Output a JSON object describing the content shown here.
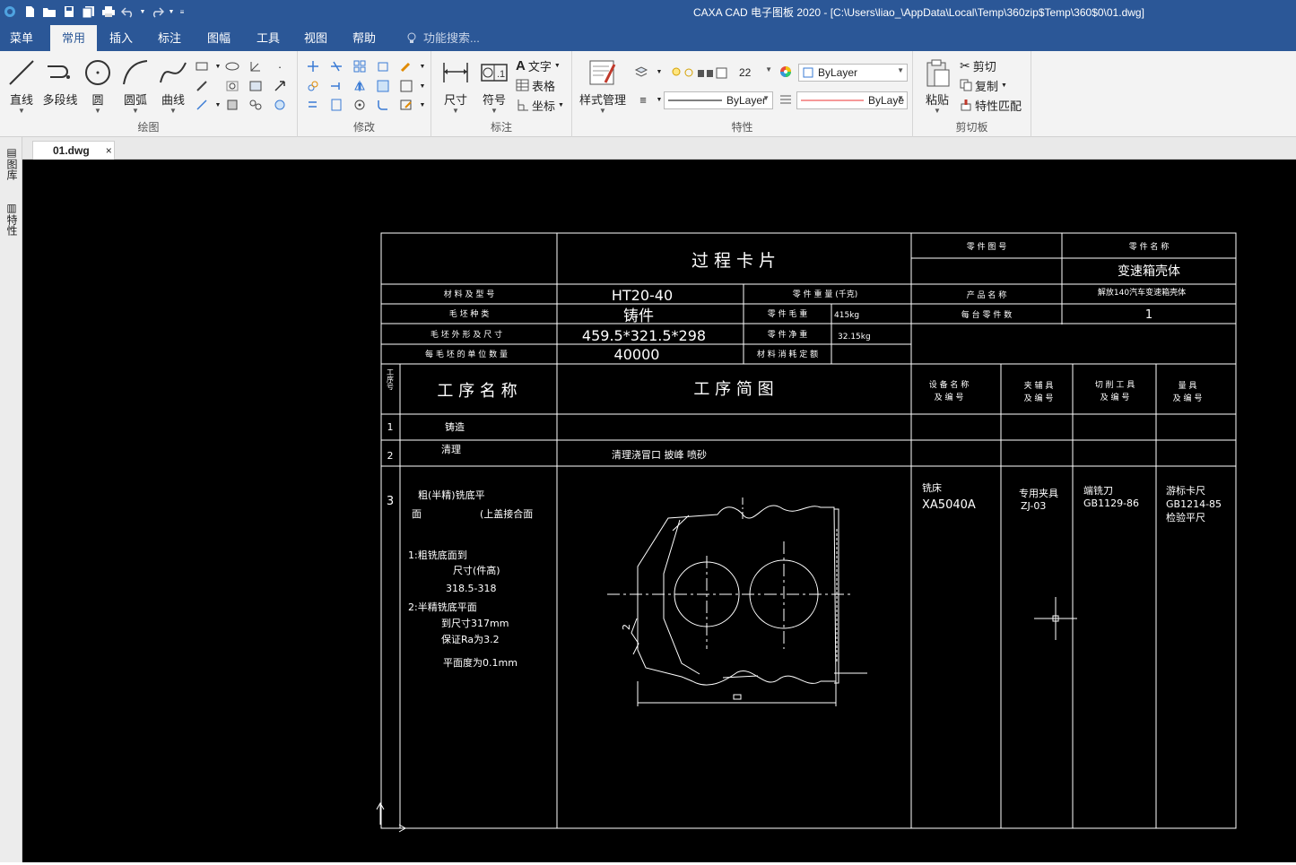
{
  "app": {
    "title": "CAXA CAD 电子图板 2020 - [C:\\Users\\liao_\\AppData\\Local\\Temp\\360zip$Temp\\360$0\\01.dwg]"
  },
  "menu": {
    "tabs": [
      "菜单",
      "常用",
      "插入",
      "标注",
      "图幅",
      "工具",
      "视图",
      "帮助"
    ],
    "active": "常用",
    "search_placeholder": "功能搜索..."
  },
  "ribbon": {
    "draw": {
      "label": "绘图",
      "line": "直线",
      "polyline": "多段线",
      "circle": "圆",
      "arc": "圆弧",
      "curve": "曲线"
    },
    "modify": {
      "label": "修改"
    },
    "annotate": {
      "label": "标注",
      "dimension": "尺寸",
      "symbol": "符号",
      "text": "文字",
      "table": "表格",
      "coord": "坐标"
    },
    "properties": {
      "label": "特性",
      "style_manager": "样式管理",
      "layer_value": "22",
      "color_value": "ByLayer",
      "linetype_value": "ByLayer",
      "lineweight_value": "ByLaye"
    },
    "clipboard": {
      "label": "剪切板",
      "paste": "粘贴",
      "cut": "剪切",
      "copy": "复制",
      "match": "特性匹配"
    }
  },
  "document": {
    "tab_name": "01.dwg",
    "close": "×"
  },
  "dock": {
    "library": "图库",
    "properties": "特性"
  },
  "drawing": {
    "title": "过    程    卡    片",
    "part_no_label": "零  件  图  号",
    "part_name_label": "零  件  名  称",
    "part_name_value": "变速箱壳体",
    "material_label": "材  料  及  型  号",
    "material_value": "HT20-40",
    "part_weight_label": "零 件 重 量 (千克)",
    "product_name_label": "产  品  名  称",
    "product_name_value": "解放140汽车变速箱壳体",
    "blank_type_label": "毛    坯    种    类",
    "blank_type_value": "铸件",
    "gross_weight_label": "零 件 毛 重",
    "gross_weight_value": "415kg",
    "per_unit_label": "每 台 零 件 数",
    "per_unit_value": "1",
    "blank_size_label": "毛  坯  外  形  及  尺  寸",
    "blank_size_value": "459.5*321.5*298",
    "net_weight_label": "零 件 净 重",
    "net_weight_value": "32.15kg",
    "units_label": "每 毛 坯 的 单 位 数 量",
    "units_value": "40000",
    "material_quota_label": "材 料 消 耗 定 额",
    "seq_header": "工序号",
    "op_name_header": "工  序  名  称",
    "sketch_header": "工    序    简    图",
    "equip_header": [
      "设 备 名 称",
      "及 编 号"
    ],
    "fixture_header": [
      "夹 辅 具",
      "及 编 号"
    ],
    "tool_header": [
      "切 削 工 具",
      "及 编 号"
    ],
    "gauge_header": [
      "量    具",
      "及 编 号"
    ],
    "rows": [
      {
        "no": "1",
        "name": "铸造",
        "sketch": ""
      },
      {
        "no": "2",
        "name": "清理",
        "sketch": "清理浇冒口  披峰  喷砂"
      },
      {
        "no": "3"
      }
    ],
    "op3": {
      "line1": "粗(半精)铣底平",
      "line2a": "面",
      "line2b": "(上盖接合面",
      "step1": "1:粗铣底面到",
      "step1b": "尺寸(件高)",
      "step1c": "318.5-318",
      "step2": "2:半精铣底平面",
      "step2b": "到尺寸317mm",
      "step2c": "保证Ra为3.2",
      "step2d": "平面度为0.1mm",
      "equip_a": "铣床",
      "equip_b": "XA5040A",
      "fixture_a": "专用夹具",
      "fixture_b": "ZJ-03",
      "tool_a": "端铣刀",
      "tool_b": "GB1129-86",
      "gauge_a": "游标卡尺",
      "gauge_b": "GB1214-85",
      "gauge_c": "检验平尺",
      "dim_label": "2"
    }
  }
}
